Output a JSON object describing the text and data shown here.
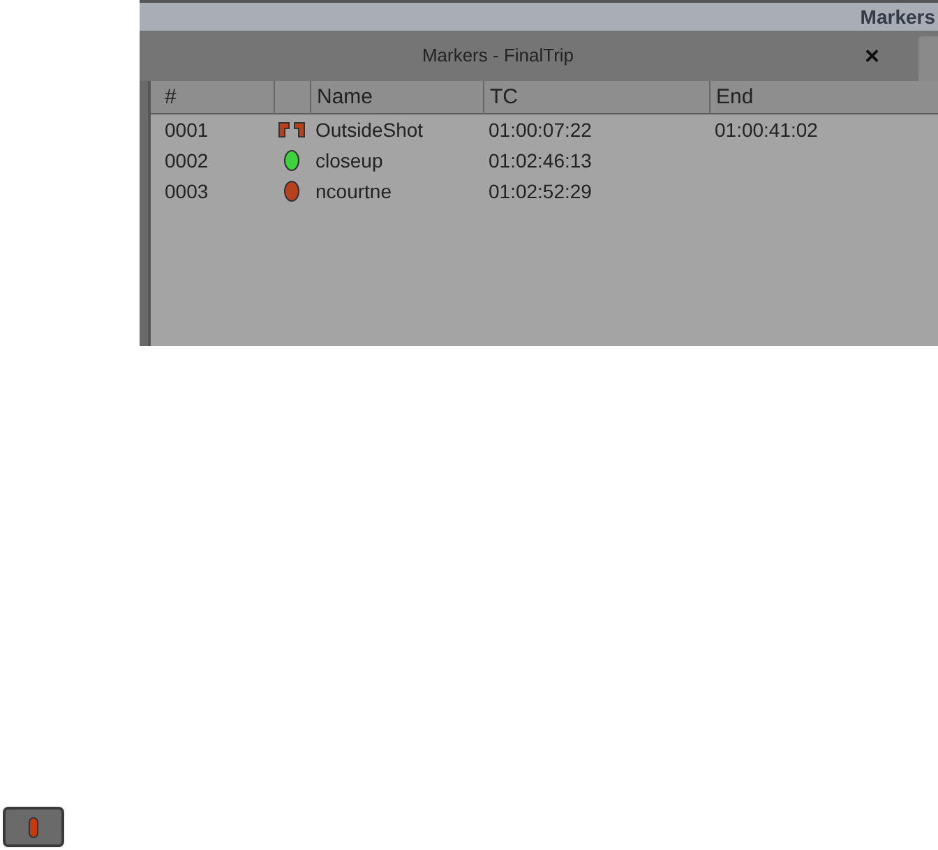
{
  "panel": {
    "title": "Markers"
  },
  "window": {
    "title": "Markers - FinalTrip",
    "close": "×"
  },
  "table": {
    "columns": [
      "#",
      "",
      "Name",
      "TC",
      "End"
    ],
    "rows": [
      {
        "number": "0001",
        "marker": {
          "kind": "span",
          "color": "#b8401c"
        },
        "name": "OutsideShot",
        "tc": "01:00:07:22",
        "end": "01:00:41:02"
      },
      {
        "number": "0002",
        "marker": {
          "kind": "dot",
          "color": "#3cd43c"
        },
        "name": "closeup",
        "tc": "01:02:46:13"
      },
      {
        "number": "0003",
        "marker": {
          "kind": "dot",
          "color": "#b8401c"
        },
        "name": "ncourtne",
        "tc": "01:02:52:29"
      }
    ]
  },
  "marker_button": {
    "color": "#c8380c"
  }
}
